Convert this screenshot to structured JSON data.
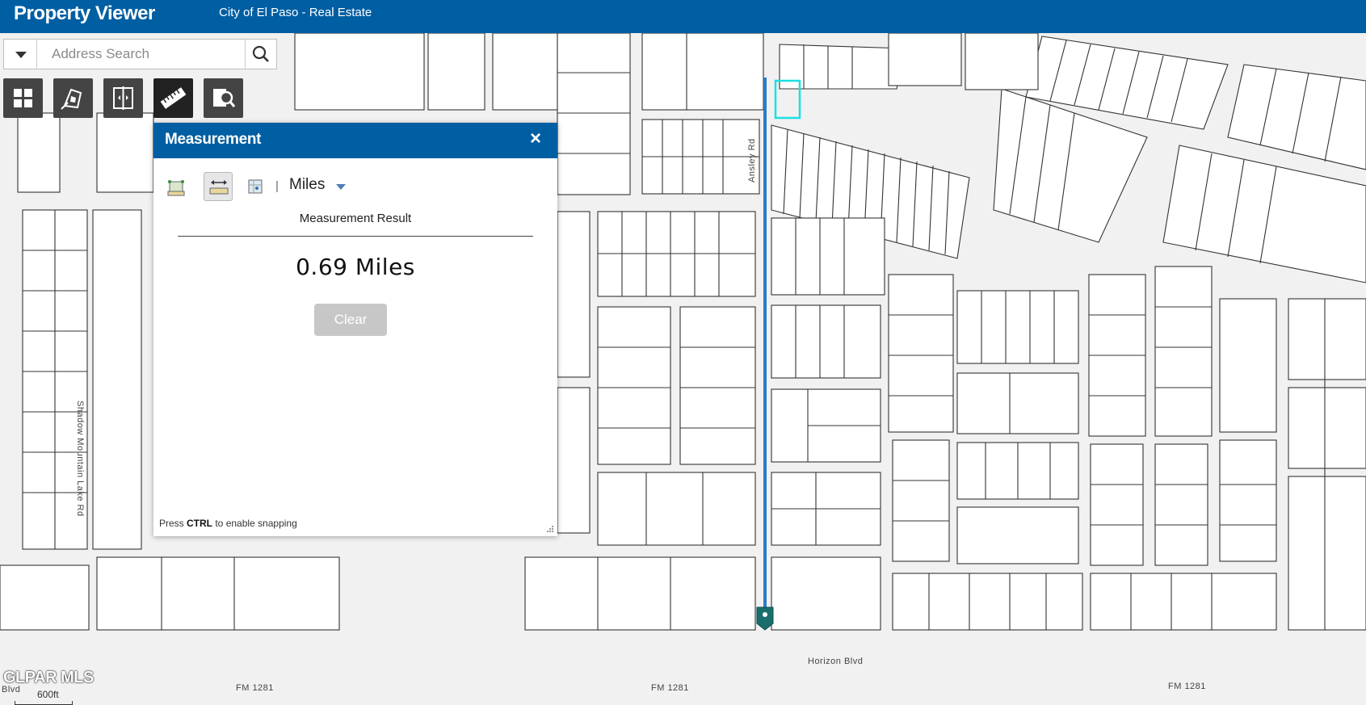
{
  "header": {
    "app_title": "Property Viewer",
    "subtitle": "City of El Paso - Real Estate"
  },
  "search": {
    "placeholder": "Address Search",
    "value": ""
  },
  "toolbar": {
    "tools": [
      {
        "icon": "basemap-grid-icon"
      },
      {
        "icon": "layers-icon"
      },
      {
        "icon": "swipe-compare-icon"
      },
      {
        "icon": "measure-ruler-icon"
      },
      {
        "icon": "identify-search-icon"
      }
    ]
  },
  "measurement_panel": {
    "title": "Measurement",
    "close_symbol": "×",
    "modes": [
      {
        "icon": "area-measure-icon"
      },
      {
        "icon": "distance-measure-icon"
      },
      {
        "icon": "location-measure-icon"
      }
    ],
    "separator": "|",
    "units": "Miles",
    "result_heading": "Measurement Result",
    "result_value": "0.69 Miles",
    "clear_label": "Clear",
    "snap_hint_prefix": "Press ",
    "snap_hint_key": "CTRL",
    "snap_hint_suffix": " to enable snapping"
  },
  "map": {
    "road_labels": {
      "ansley": "Ansley Rd",
      "shadow_mountain": "Shadow Mountain Lake Rd",
      "horizon": "Horizon Blvd",
      "fm1": "FM 1281",
      "fm2": "FM 1281",
      "fm3": "FM 1281",
      "blvd": "Blvd"
    },
    "measure_line_color": "#2b7bc9",
    "selected_parcel_color": "#19e0e6"
  },
  "watermark": "GLPAR MLS",
  "scale_bar": {
    "label": "600ft"
  }
}
